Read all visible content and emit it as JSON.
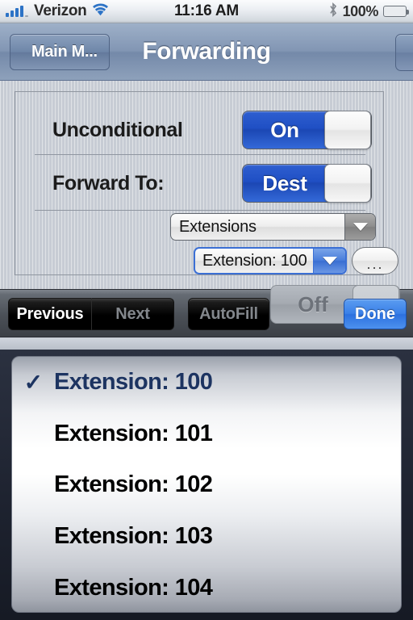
{
  "status_bar": {
    "carrier": "Verizon",
    "signal_bars": 5,
    "signal_active": 4,
    "wifi_icon": "wifi-icon",
    "time": "11:16 AM",
    "bluetooth_icon": "bluetooth-icon",
    "battery_percent": "100%",
    "battery_level": 100,
    "battery_color": "#4cb92c",
    "accent_blue": "#2c73c6"
  },
  "nav_bar": {
    "back_label": "Main M...",
    "title": "Forwarding",
    "right_button_label": ""
  },
  "form": {
    "rows": [
      {
        "label": "Unconditional",
        "switch_label": "On",
        "switch_state": "on"
      },
      {
        "label": "Forward To:",
        "switch_label": "Dest",
        "switch_state": "on"
      }
    ],
    "category_select": {
      "value": "Extensions",
      "arrow_icon": "chevron-down-icon",
      "focused": false
    },
    "extension_select": {
      "value": "Extension: 100",
      "arrow_icon": "chevron-down-icon",
      "focused": true
    },
    "more_button_label": "...",
    "ghost_switch_label": "Off"
  },
  "accessory_bar": {
    "previous_label": "Previous",
    "previous_enabled": true,
    "next_label": "Next",
    "next_enabled": false,
    "autofill_label": "AutoFill",
    "autofill_enabled": false,
    "done_label": "Done",
    "done_color": "#3a80e8"
  },
  "picker": {
    "checkmark_glyph": "✓",
    "selected_index": 0,
    "selected_color": "#1d3461",
    "options": [
      "Extension: 100",
      "Extension: 101",
      "Extension: 102",
      "Extension: 103",
      "Extension: 104"
    ]
  }
}
